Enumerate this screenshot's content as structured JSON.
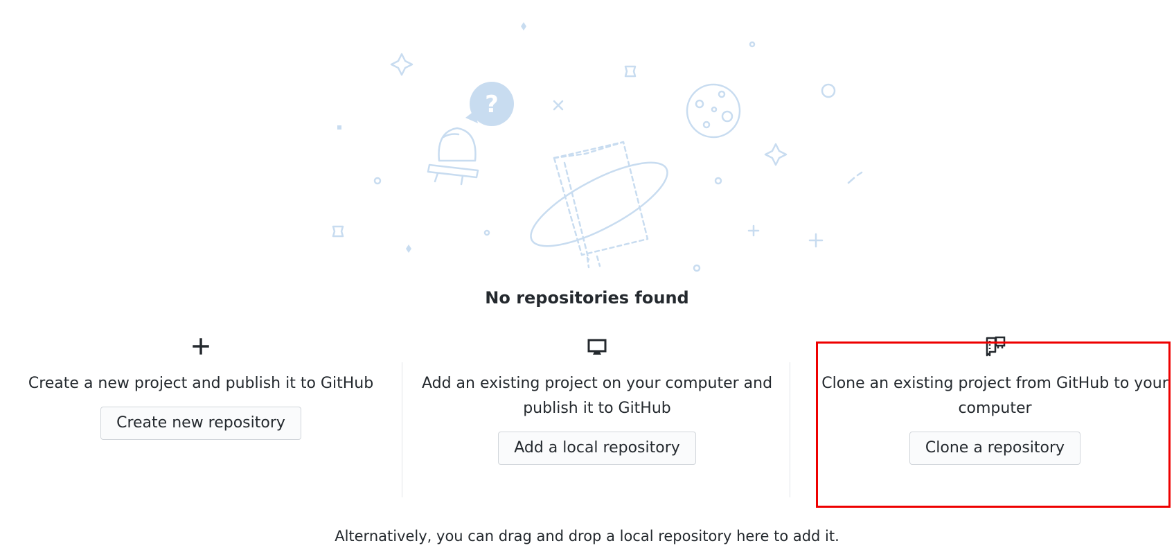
{
  "empty_state": {
    "title": "No repositories found",
    "footer_hint": "Alternatively, you can drag and drop a local repository here to add it."
  },
  "actions": [
    {
      "icon": "plus-icon",
      "description": "Create a new project and publish it to GitHub",
      "button_label": "Create new repository"
    },
    {
      "icon": "desktop-icon",
      "description": "Add an existing project on your computer and publish it to GitHub",
      "button_label": "Add a local repository"
    },
    {
      "icon": "repo-clone-icon",
      "description": "Clone an existing project from GitHub to your computer",
      "button_label": "Clone a repository"
    }
  ],
  "colors": {
    "illustration": "#c8dcf0",
    "text": "#24292e",
    "button_bg": "#fafbfc",
    "button_border": "#d1d5da",
    "divider": "#e1e4e8",
    "highlight": "#ee0000"
  }
}
